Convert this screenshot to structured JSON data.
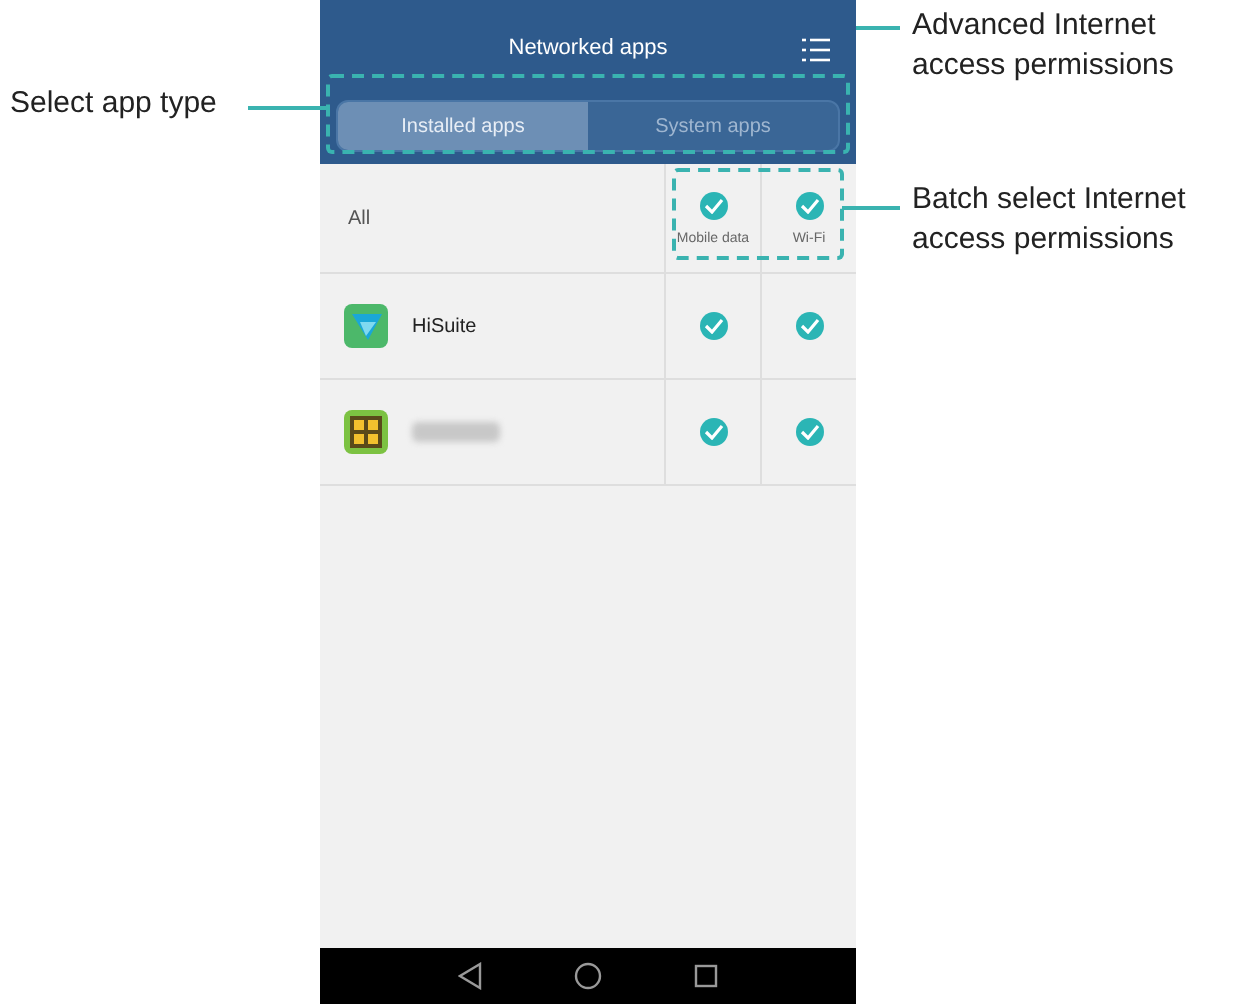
{
  "screen": {
    "title": "Networked apps",
    "tabs": [
      {
        "label": "Installed apps",
        "selected": true
      },
      {
        "label": "System apps",
        "selected": false
      }
    ],
    "all_row": {
      "label": "All",
      "columns": [
        {
          "label": "Mobile data",
          "checked": true
        },
        {
          "label": "Wi-Fi",
          "checked": true
        }
      ]
    },
    "apps": [
      {
        "name": "HiSuite",
        "mobile_data": true,
        "wifi": true
      },
      {
        "redacted": true,
        "mobile_data": true,
        "wifi": true
      }
    ]
  },
  "callouts": [
    {
      "text": "Select app type"
    },
    {
      "text": "Advanced Internet access permissions"
    },
    {
      "text": "Batch select Internet access permissions"
    }
  ]
}
